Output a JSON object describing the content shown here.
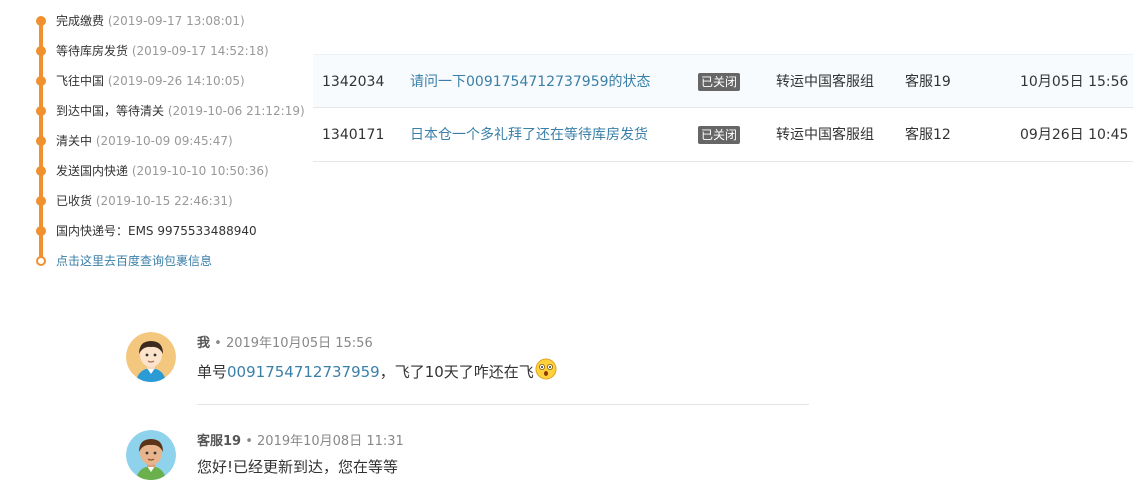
{
  "timeline": {
    "items": [
      {
        "label": "完成缴费",
        "time": "(2019-09-17 13:08:01)"
      },
      {
        "label": "等待库房发货",
        "time": "(2019-09-17 14:52:18)"
      },
      {
        "label": "飞往中国",
        "time": "(2019-09-26 14:10:05)"
      },
      {
        "label": "到达中国，等待清关",
        "time": "(2019-10-06 21:12:19)"
      },
      {
        "label": "清关中",
        "time": "(2019-10-09 09:45:47)"
      },
      {
        "label": "发送国内快递",
        "time": "(2019-10-10 10:50:36)"
      },
      {
        "label": "已收货",
        "time": "(2019-10-15 22:46:31)"
      },
      {
        "label": "国内快递号：EMS 9975533488940",
        "time": ""
      }
    ],
    "link": "点击这里去百度查询包裹信息",
    "accent_color": "#f0902e"
  },
  "tickets": {
    "rows": [
      {
        "id": "1342034",
        "subject": "请问一下0091754712737959的状态",
        "status": "已关闭",
        "group": "转运中国客服组",
        "agent": "客服19",
        "date": "10月05日 15:56"
      },
      {
        "id": "1340171",
        "subject": "日本仓一个多礼拜了还在等待库房发货",
        "status": "已关闭",
        "group": "转运中国客服组",
        "agent": "客服12",
        "date": "09月26日 10:45"
      }
    ]
  },
  "messages": [
    {
      "author": "我",
      "separator": " • ",
      "time": "2019年10月05日 15:56",
      "prefix": "单号",
      "link": "0091754712737959",
      "suffix": "，飞了10天了咋还在飞",
      "emoji": "shocked-face-icon"
    },
    {
      "author": "客服19",
      "separator": " • ",
      "time": "2019年10月08日 11:31",
      "text": "您好!已经更新到达，您在等等"
    }
  ]
}
